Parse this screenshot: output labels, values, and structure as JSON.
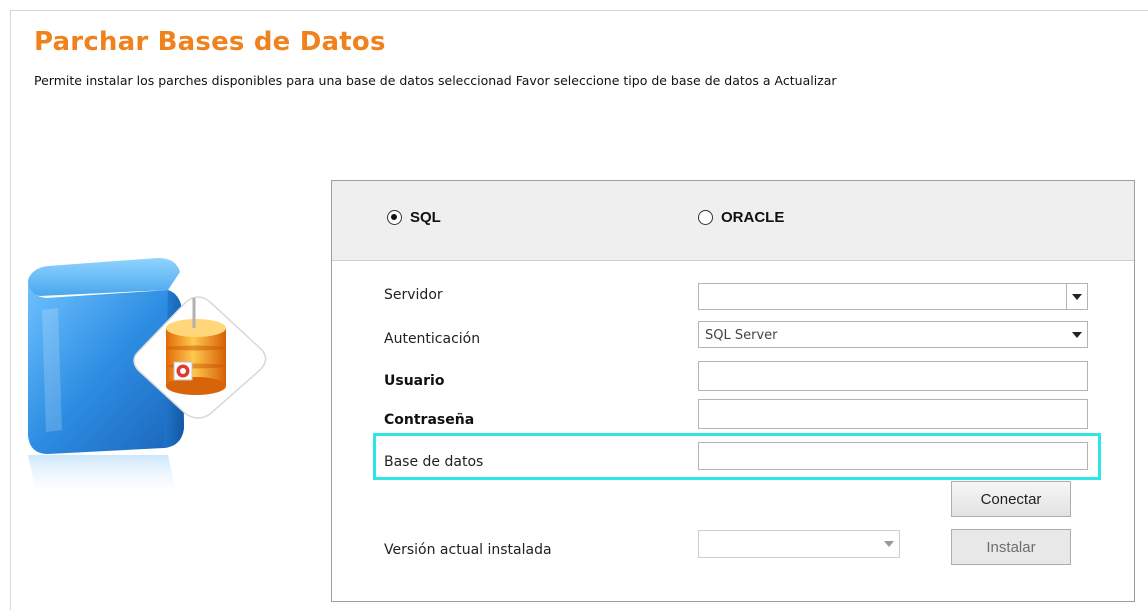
{
  "header": {
    "title": "Parchar Bases de Datos",
    "subtitle": "Permite instalar los parches disponibles para una base de datos seleccionad Favor seleccione tipo de base de datos a Actualizar"
  },
  "db_type": {
    "options": [
      {
        "label": "SQL",
        "selected": true
      },
      {
        "label": "ORACLE",
        "selected": false
      }
    ]
  },
  "form": {
    "servidor": {
      "label": "Servidor",
      "value": ""
    },
    "autenticacion": {
      "label": "Autenticación",
      "value": "SQL Server"
    },
    "usuario": {
      "label": "Usuario",
      "value": ""
    },
    "contrasena": {
      "label": "Contraseña",
      "value": ""
    },
    "base_datos": {
      "label": "Base de datos",
      "value": ""
    },
    "version": {
      "label": "Versión actual instalada",
      "value": ""
    }
  },
  "buttons": {
    "conectar": "Conectar",
    "instalar": "Instalar"
  },
  "colors": {
    "title": "#f0821e",
    "highlight": "#2ee6e6",
    "cube_blue": "#2f8ee0",
    "db_orange": "#f5a21a"
  },
  "icons": {
    "hero": "database-cube-icon",
    "badge": "database-patch-icon"
  }
}
